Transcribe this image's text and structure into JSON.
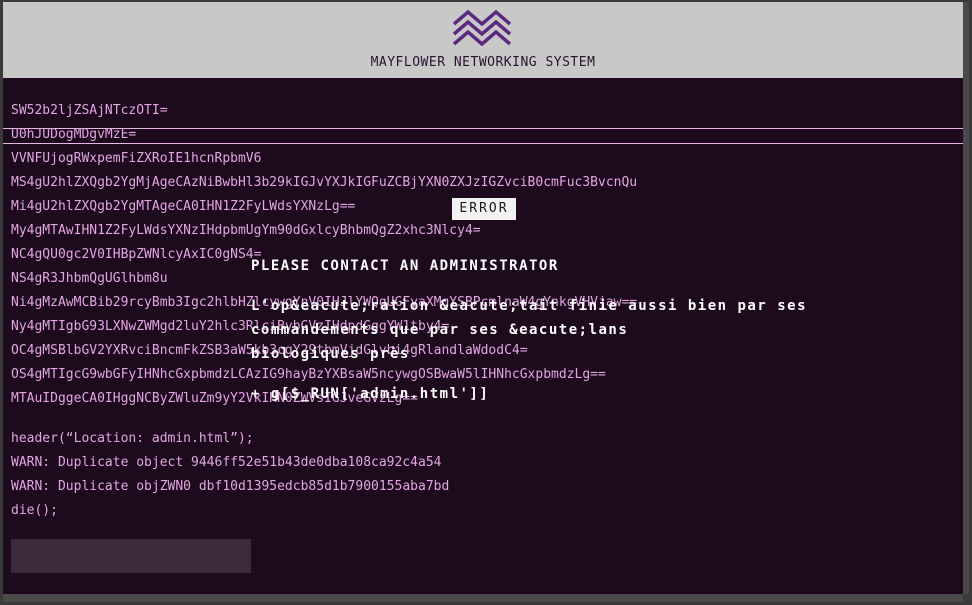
{
  "header": {
    "title": "MAYFLOWER NETWORKING SYSTEM",
    "logo_icon": "mountain-wave-logo",
    "logo_color": "#5b2a80"
  },
  "log_lines": [
    "SW52b2ljZSAjNTczOTI=",
    "U0hJUDogMDgvMzE=",
    "VVNFUjogRWxpemFiZXRoIE1hcnRpbmV6",
    "MS4gU2hlZXQgb2YgMjAgeCAzNiBwbHl3b29kIGJvYXJkIGFuZCBjYXN0ZXJzIGZvciB0cmFuc3BvcnQu",
    "Mi4gU2hlZXQgb2YgMTAgeCA0IHN1Z2FyLWdsYXNzLg==",
    "My4gMTAwIHN1Z2FyLWdsYXNzIHdpbmUgYm90dGxlcyBhbmQgZ2xhc3Nlcy4=",
    "NC4gQU0gc2V0IHBpZWNlcyAxIC0gNS4=",
    "NS4gR3JhbmQgUGlhbm8u",
    "Ni4gMzAwMCBib29rcyBmb3Igc2hlbHZlcywgYnV0IHJlYWQgUGFyaXMgYSBPcmlnaW4gYnkgVHVjaw==",
    "Ny4gMTIgbG93LXNwZWMgd2luY2hlc3RlciBybGVzIHdpdGggYW1tby4=",
    "OC4gMSBlbGV2YXRvciBncmFkZSB3aW5kb3cgY29tbmVjdGlvbi4gRlandlaWdodC4=",
    "OS4gMTIgcG9wbGFyIHNhcGxpbmdzLCAzIG9hayBzYXBsaW5ncywgOSBwaW5lIHNhcGxpbmdzLg==",
    "MTAuIDggeCA0IHggNCByZWluZm9yY2VkIHN0ZWVsIGJveGVzLg=="
  ],
  "code_lines": [
    "header(“Location: admin.html”);",
    "WARN: Duplicate object 9446ff52e51b43de0dba108ca92c4a54",
    "WARN: Duplicate objZWN0 dbf10d1395edcb85d1b7900155aba7bd",
    "die();"
  ],
  "error": {
    "label": "ERROR",
    "message": "PLEASE CONTACT AN ADMINISTRATOR"
  },
  "overlay_lines": [
    "L'op&eacute;ration &eacute;tait finie aussi bien par ses",
    "commandements que par ses &eacute;lans",
    "biologiques près",
    "+ g[$_RUN['admin.html']]"
  ],
  "colors": {
    "background": "#1d0a1d",
    "header_bg": "#c8c8c8",
    "log_text": "#e2a6e2"
  }
}
